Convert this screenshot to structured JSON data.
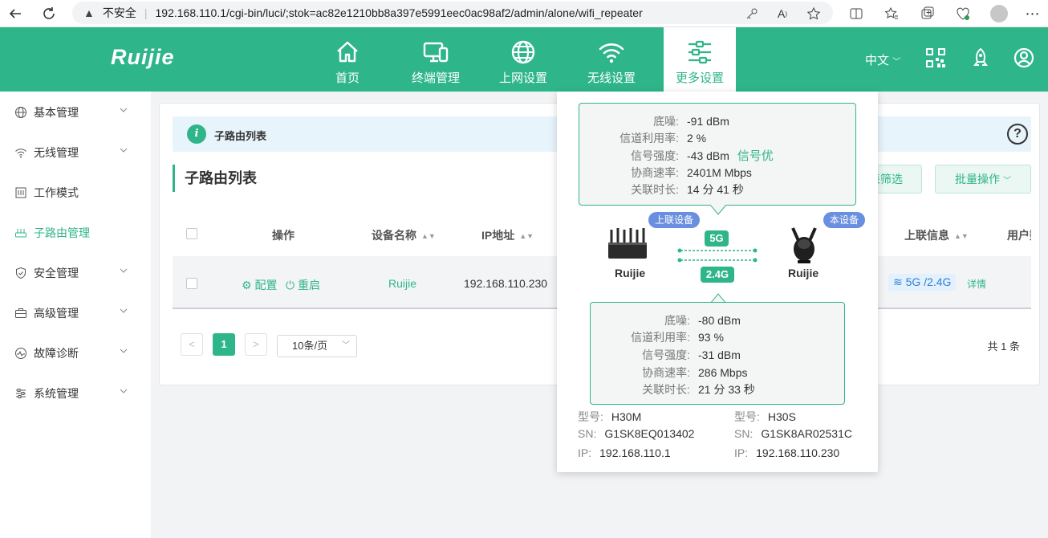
{
  "browser": {
    "security": "不安全",
    "url": "192.168.110.1/cgi-bin/luci/;stok=ac82e1210bb8a397e5991eec0ac98af2/admin/alone/wifi_repeater"
  },
  "brand": "Ruijie",
  "nav": [
    {
      "label": "首页",
      "icon": "home-icon"
    },
    {
      "label": "终端管理",
      "icon": "devices-icon"
    },
    {
      "label": "上网设置",
      "icon": "globe-icon"
    },
    {
      "label": "无线设置",
      "icon": "wifi-icon"
    },
    {
      "label": "更多设置",
      "icon": "sliders-icon"
    }
  ],
  "lang": "中文",
  "sidebar": [
    {
      "label": "基本管理"
    },
    {
      "label": "无线管理"
    },
    {
      "label": "工作模式"
    },
    {
      "label": "子路由管理"
    },
    {
      "label": "安全管理"
    },
    {
      "label": "高级管理"
    },
    {
      "label": "故障诊断"
    },
    {
      "label": "系统管理"
    }
  ],
  "info": {
    "title": "子路由列表"
  },
  "section_title": "子路由列表",
  "buttons": {
    "filter": "表筛选",
    "batch": "批量操作"
  },
  "table": {
    "headers": {
      "op": "操作",
      "name": "设备名称",
      "ip": "IP地址",
      "uplink": "上联信息",
      "user": "用户数"
    },
    "row": {
      "config": "配置",
      "reboot": "重启",
      "name": "Ruijie",
      "ip": "192.168.110.230",
      "uplink": "5G /2.4G",
      "detail": "详情"
    }
  },
  "pagination": {
    "prev": "<",
    "page": "1",
    "next": ">",
    "size": "10条/页",
    "total": "共 1 条"
  },
  "popup": {
    "top": {
      "noise_k": "底噪:",
      "noise": "-91 dBm",
      "util_k": "信道利用率:",
      "util": "2 %",
      "signal_k": "信号强度:",
      "signal": "-43 dBm",
      "quality": "信号优",
      "rate_k": "协商速率:",
      "rate": "2401M Mbps",
      "time_k": "关联时长:",
      "time": "14 分 41 秒"
    },
    "uplink_tag": "上联设备",
    "local_tag": "本设备",
    "band5": "5G",
    "band24": "2.4G",
    "left_name": "Ruijie",
    "right_name": "Ruijie",
    "bottom": {
      "noise_k": "底噪:",
      "noise": "-80 dBm",
      "util_k": "信道利用率:",
      "util": "93 %",
      "signal_k": "信号强度:",
      "signal": "-31 dBm",
      "rate_k": "协商速率:",
      "rate": "286 Mbps",
      "time_k": "关联时长:",
      "time": "21 分 33 秒"
    },
    "left": {
      "model_k": "型号:",
      "model": "H30M",
      "sn_k": "SN:",
      "sn": "G1SK8EQ013402",
      "ip_k": "IP:",
      "ip": "192.168.110.1"
    },
    "right": {
      "model_k": "型号:",
      "model": "H30S",
      "sn_k": "SN:",
      "sn": "G1SK8AR02531C",
      "ip_k": "IP:",
      "ip": "192.168.110.230"
    }
  },
  "colors": {
    "brand": "#2fb58a",
    "tag": "#6b8fe0"
  }
}
